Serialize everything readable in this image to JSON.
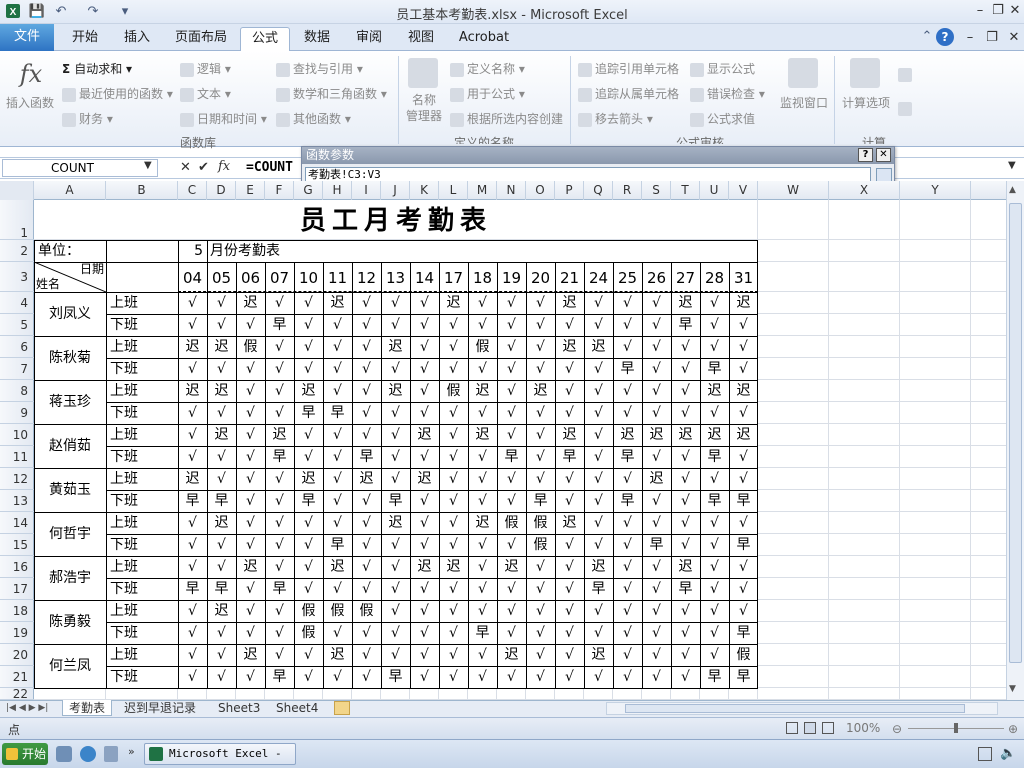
{
  "window": {
    "title": "员工基本考勤表.xlsx - Microsoft Excel"
  },
  "tabs": [
    "文件",
    "开始",
    "插入",
    "页面布局",
    "公式",
    "数据",
    "审阅",
    "视图",
    "Acrobat"
  ],
  "ribbon": {
    "insert_function": "插入函数",
    "lib_col1": [
      "自动求和 ▾",
      "最近使用的函数 ▾",
      "财务 ▾"
    ],
    "lib_col2": [
      "逻辑 ▾",
      "文本 ▾",
      "日期和时间 ▾"
    ],
    "lib_col3": [
      "查找与引用 ▾",
      "数学和三角函数 ▾",
      "其他函数 ▾"
    ],
    "group_library": "函数库",
    "name_manager": "名称\n管理器",
    "names_col": [
      "定义名称 ▾",
      "用于公式 ▾",
      "根据所选内容创建"
    ],
    "group_names": "定义的名称",
    "audit_col1": [
      "追踪引用单元格",
      "追踪从属单元格",
      "移去箭头 ▾"
    ],
    "audit_col2": [
      "显示公式",
      "错误检查 ▾",
      "公式求值"
    ],
    "group_audit": "公式审核",
    "watch_window": "监视窗口",
    "calc_options": "计算选项",
    "group_calc": "计算"
  },
  "formula_bar": {
    "name_box": "COUNT",
    "fx": "fx",
    "formula": "=COUNT"
  },
  "dialog": {
    "title": "函数参数",
    "value": "考勤表!C3:V3"
  },
  "columns": [
    "A",
    "B",
    "C",
    "D",
    "E",
    "F",
    "G",
    "H",
    "I",
    "J",
    "K",
    "L",
    "M",
    "N",
    "O",
    "P",
    "Q",
    "R",
    "S",
    "T",
    "U",
    "V",
    "W",
    "X",
    "Y"
  ],
  "rows": [
    "1",
    "2",
    "3",
    "4",
    "5",
    "6",
    "7",
    "8",
    "9",
    "10",
    "11",
    "12",
    "13",
    "14",
    "15",
    "16",
    "17",
    "18",
    "19",
    "20",
    "21",
    "22"
  ],
  "sheet": {
    "title": "员工月考勤表",
    "unit_label": "单位：",
    "month": "5",
    "month_label": "月份考勤表",
    "diag_top": "日期",
    "diag_bottom": "姓名",
    "dates": [
      "04",
      "05",
      "06",
      "07",
      "10",
      "11",
      "12",
      "13",
      "14",
      "17",
      "18",
      "19",
      "20",
      "21",
      "24",
      "25",
      "26",
      "27",
      "28",
      "31"
    ],
    "shift_on": "上班",
    "shift_off": "下班",
    "employees": [
      {
        "name": "刘凤义",
        "on": [
          "√",
          "√",
          "迟",
          "√",
          "√",
          "迟",
          "√",
          "√",
          "√",
          "迟",
          "√",
          "√",
          "√",
          "迟",
          "√",
          "√",
          "√",
          "迟",
          "√",
          "迟"
        ],
        "off": [
          "√",
          "√",
          "√",
          "早",
          "√",
          "√",
          "√",
          "√",
          "√",
          "√",
          "√",
          "√",
          "√",
          "√",
          "√",
          "√",
          "√",
          "早",
          "√",
          "√"
        ]
      },
      {
        "name": "陈秋菊",
        "on": [
          "迟",
          "迟",
          "假",
          "√",
          "√",
          "√",
          "√",
          "迟",
          "√",
          "√",
          "假",
          "√",
          "√",
          "迟",
          "迟",
          "√",
          "√",
          "√",
          "√",
          "√"
        ],
        "off": [
          "√",
          "√",
          "√",
          "√",
          "√",
          "√",
          "√",
          "√",
          "√",
          "√",
          "√",
          "√",
          "√",
          "√",
          "√",
          "早",
          "√",
          "√",
          "早",
          "√"
        ]
      },
      {
        "name": "蒋玉珍",
        "on": [
          "迟",
          "迟",
          "√",
          "√",
          "迟",
          "√",
          "√",
          "迟",
          "√",
          "假",
          "迟",
          "√",
          "迟",
          "√",
          "√",
          "√",
          "√",
          "√",
          "迟",
          "迟"
        ],
        "off": [
          "√",
          "√",
          "√",
          "√",
          "早",
          "早",
          "√",
          "√",
          "√",
          "√",
          "√",
          "√",
          "√",
          "√",
          "√",
          "√",
          "√",
          "√",
          "√",
          "√"
        ]
      },
      {
        "name": "赵俏茹",
        "on": [
          "√",
          "迟",
          "√",
          "迟",
          "√",
          "√",
          "√",
          "√",
          "迟",
          "√",
          "迟",
          "√",
          "√",
          "迟",
          "√",
          "迟",
          "迟",
          "迟",
          "迟",
          "迟"
        ],
        "off": [
          "√",
          "√",
          "√",
          "早",
          "√",
          "√",
          "早",
          "√",
          "√",
          "√",
          "√",
          "早",
          "√",
          "早",
          "√",
          "早",
          "√",
          "√",
          "早",
          "√"
        ]
      },
      {
        "name": "黄茹玉",
        "on": [
          "迟",
          "√",
          "√",
          "√",
          "迟",
          "√",
          "迟",
          "√",
          "迟",
          "√",
          "√",
          "√",
          "√",
          "√",
          "√",
          "√",
          "迟",
          "√",
          "√",
          "√"
        ],
        "off": [
          "早",
          "早",
          "√",
          "√",
          "早",
          "√",
          "√",
          "早",
          "√",
          "√",
          "√",
          "√",
          "早",
          "√",
          "√",
          "早",
          "√",
          "√",
          "早",
          "早"
        ]
      },
      {
        "name": "何哲宇",
        "on": [
          "√",
          "迟",
          "√",
          "√",
          "√",
          "√",
          "√",
          "迟",
          "√",
          "√",
          "迟",
          "假",
          "假",
          "迟",
          "√",
          "√",
          "√",
          "√",
          "√",
          "√"
        ],
        "off": [
          "√",
          "√",
          "√",
          "√",
          "√",
          "早",
          "√",
          "√",
          "√",
          "√",
          "√",
          "√",
          "假",
          "√",
          "√",
          "√",
          "早",
          "√",
          "√",
          "早"
        ]
      },
      {
        "name": "郝浩宇",
        "on": [
          "√",
          "√",
          "迟",
          "√",
          "√",
          "迟",
          "√",
          "√",
          "迟",
          "迟",
          "√",
          "迟",
          "√",
          "√",
          "迟",
          "√",
          "√",
          "迟",
          "√",
          "√"
        ],
        "off": [
          "早",
          "早",
          "√",
          "早",
          "√",
          "√",
          "√",
          "√",
          "√",
          "√",
          "√",
          "√",
          "√",
          "√",
          "早",
          "√",
          "√",
          "早",
          "√",
          "√"
        ]
      },
      {
        "name": "陈勇毅",
        "on": [
          "√",
          "迟",
          "√",
          "√",
          "假",
          "假",
          "假",
          "√",
          "√",
          "√",
          "√",
          "√",
          "√",
          "√",
          "√",
          "√",
          "√",
          "√",
          "√",
          "√"
        ],
        "off": [
          "√",
          "√",
          "√",
          "√",
          "假",
          "√",
          "√",
          "√",
          "√",
          "√",
          "早",
          "√",
          "√",
          "√",
          "√",
          "√",
          "√",
          "√",
          "√",
          "早"
        ]
      },
      {
        "name": "何兰凤",
        "on": [
          "√",
          "√",
          "迟",
          "√",
          "√",
          "迟",
          "√",
          "√",
          "√",
          "√",
          "√",
          "迟",
          "√",
          "√",
          "迟",
          "√",
          "√",
          "√",
          "√",
          "假"
        ],
        "off": [
          "√",
          "√",
          "√",
          "早",
          "√",
          "√",
          "√",
          "早",
          "√",
          "√",
          "√",
          "√",
          "√",
          "√",
          "√",
          "√",
          "√",
          "√",
          "早",
          "早"
        ]
      }
    ]
  },
  "sheet_tabs": [
    "考勤表",
    "迟到早退记录",
    "Sheet3",
    "Sheet4"
  ],
  "status": {
    "mode": "点",
    "zoom": "100%"
  },
  "taskbar": {
    "start": "开始",
    "task": "Microsoft Excel - ..."
  }
}
